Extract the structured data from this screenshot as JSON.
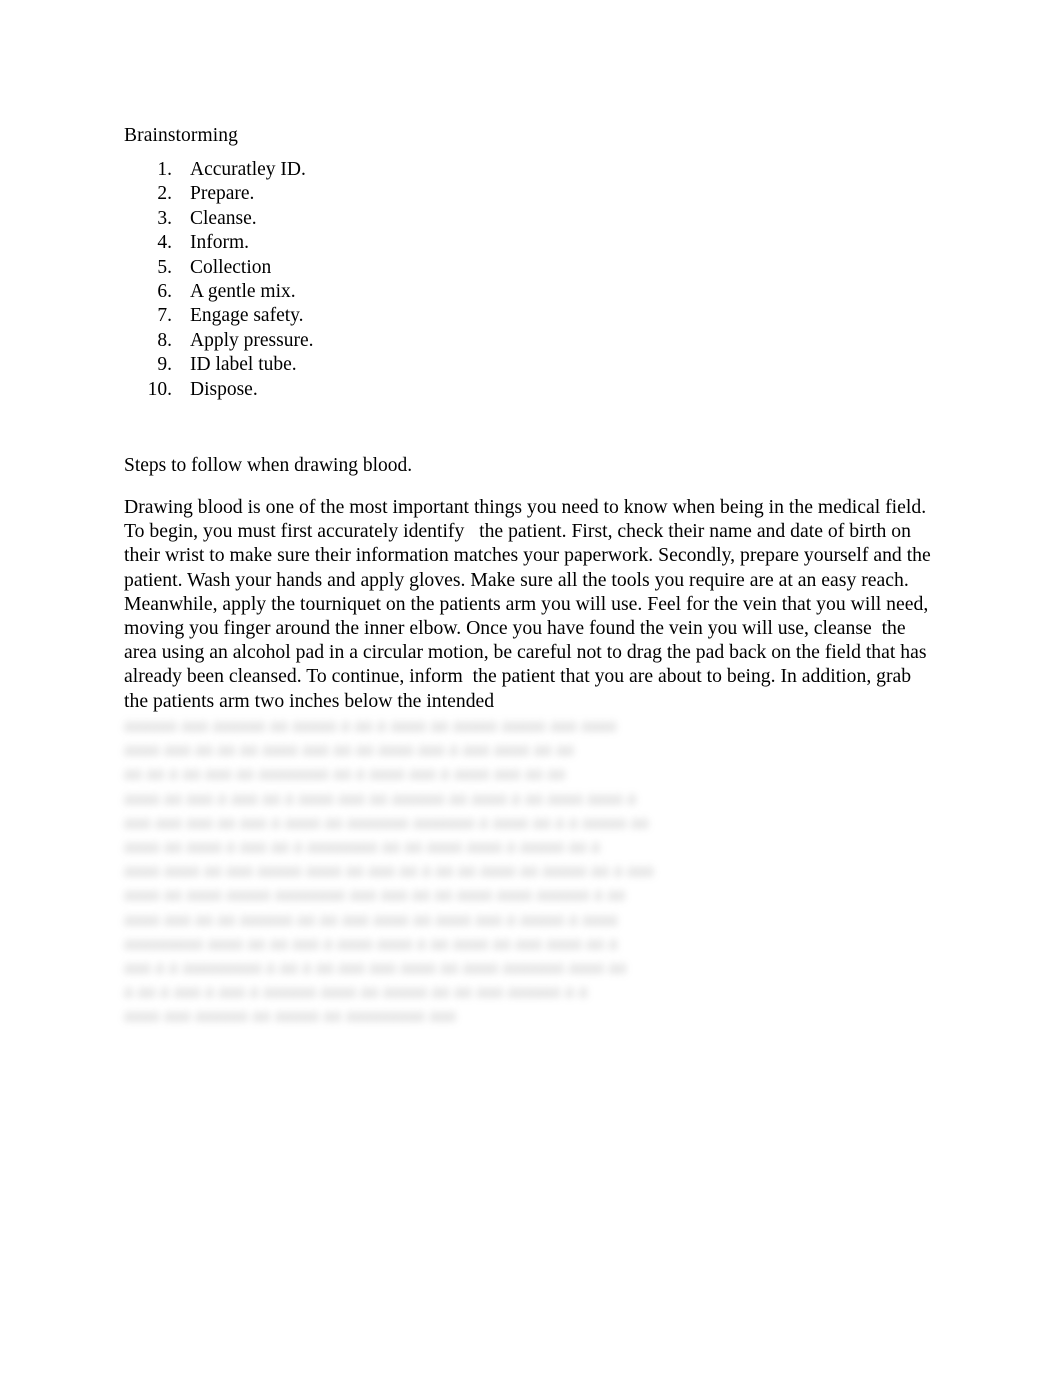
{
  "document": {
    "background_color": "#ffffff",
    "text_color": "#000000",
    "heading": "Brainstorming",
    "brainstorm_list": [
      {
        "number": "1.",
        "label": "Accuratley ID."
      },
      {
        "number": "2.",
        "label": "Prepare."
      },
      {
        "number": "3.",
        "label": "Cleanse."
      },
      {
        "number": "4.",
        "label": "Inform."
      },
      {
        "number": "5.",
        "label": "Collection"
      },
      {
        "number": "6.",
        "label": "A gentle mix."
      },
      {
        "number": "7.",
        "label": "Engage safety."
      },
      {
        "number": "8.",
        "label": "Apply pressure."
      },
      {
        "number": "9.",
        "label": "ID label tube."
      },
      {
        "number": "10.",
        "label": "Dispose."
      }
    ],
    "section_heading": "Steps to follow when drawing blood.",
    "body_paragraph": "Drawing blood is one of the most important things you need to know when being in the medical field. To begin, you must first accurately identify   the patient. First, check their name and date of birth on their wrist to make sure their information matches your paperwork. Secondly, prepare yourself and the patient. Wash your hands and apply gloves. Make sure all the tools you require are at an easy reach. Meanwhile, apply the tourniquet on the patients arm you will use. Feel for the vein that you will need, moving you finger around the inner elbow. Once you have found the vein you will use, cleanse  the area using an alcohol pad in a circular motion, be careful not to drag the pad back on the field that has already been cleansed. To continue, inform  the patient that you are about to being. In addition, grab the patients arm two inches below the intended",
    "redacted_continuation": {
      "note": "illegible blurred text",
      "blur_color": "#8d8d8d",
      "lines": [
        "aaaaaa aaa aaaaaa aa aaaaa a aa a aaaa aa aaaaa aaaaa aaa aaaa",
        "aaaa aaa aa aa aa aaaa aaa aa aa aaaa aaa a aaa aaaa aa aa",
        "aa aa a aa aaa aa aaaaaaaa aa a aaaa aaa a aaaa aaa aa aa",
        "aaaa aa aaa a aaa aa a aaaa aaa aa aaaaaa aa aaaa a aa aaaa aaaa a",
        "aaa aaa aaa aa aaa a aaaa aa aaaaaaa aaaaaaa a aaaa aa a a aaaaa aa",
        "aaaa aa aaaa a aaa aa a aaaaaaaa aa aa aaaa aaaa a aaaaa aa a",
        "aaaa aaaa aa aaa aaaaa aaaa aa aaa aa a aa aa aaaa aa aaaaa aa a aaa",
        "aaaa aa aaaa aaaaa aaaaaaaa aaa aaa aa aa aaaa aaaa aaaaaa a aa",
        "aaaa aaa aa aa aaaaaa aa aa aaa aaaa aa aaaa aaa a aaaaa a aaaa",
        "aaaaaaaaa aaaa aa aa aaa a aaaa aaaa a aa aaaa aa aaa aaaa aa a",
        "aaa a a aaaaaaaaa a aa a aa aaa aaa aaaa aa aaaa aaaaaaa aaaa aa",
        "a aa a aaa a aaa a aaaaaa aaaa aa aaaaa aa aa aaa aaaaaa a a",
        "aaaa aaa aaaaaa aa aaaaa aa aaaaaaaaa aaa"
      ]
    }
  }
}
